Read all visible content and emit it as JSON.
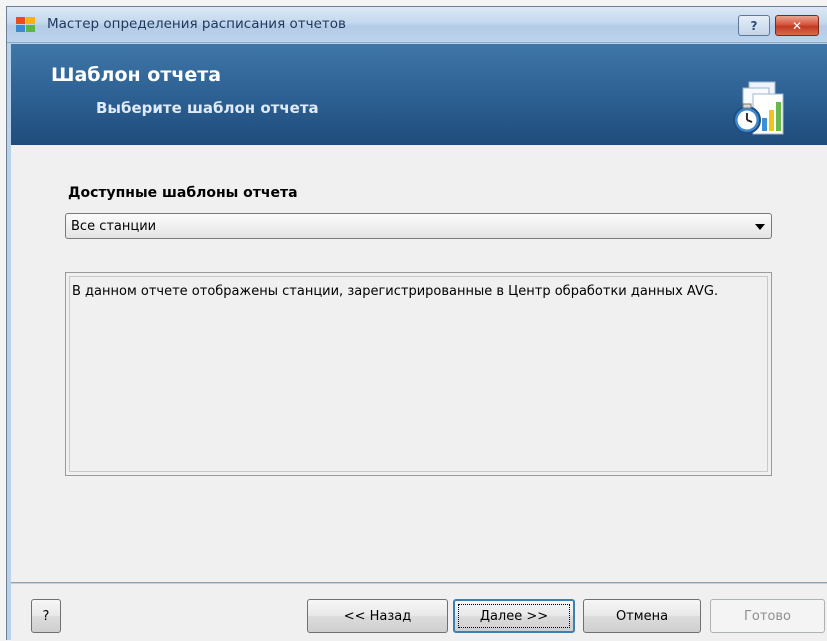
{
  "window": {
    "title": "Мастер определения расписания отчетов",
    "help_label": "?",
    "close_label": "✕"
  },
  "header": {
    "title": "Шаблон отчета",
    "subtitle": "Выберите шаблон отчета"
  },
  "main": {
    "templates_label": "Доступные шаблоны отчета",
    "selected_template": "Все станции",
    "description": "В данном отчете отображены станции, зарегистрированные в Центр обработки данных AVG."
  },
  "footer": {
    "help_label": "?",
    "back_label": "<< Назад",
    "next_label": "Далее >>",
    "cancel_label": "Отмена",
    "finish_label": "Готово"
  },
  "icons": {
    "app": "avg-logo-icon",
    "header": "report-schedule-icon"
  },
  "colors": {
    "header_bg": "#2c5f92",
    "titlebar_bg": "#c4d8ee",
    "close_button": "#c03a22",
    "focus_border": "#3c7fb1"
  }
}
